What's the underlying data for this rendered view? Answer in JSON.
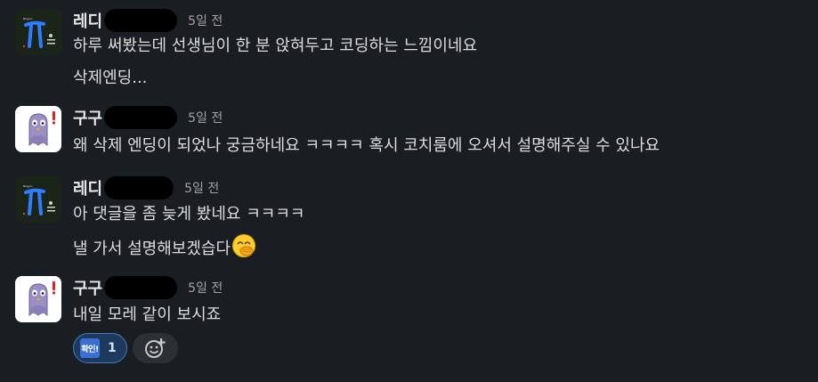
{
  "messages": [
    {
      "username": "레디",
      "timestamp": "5일 전",
      "avatar_icon": "blue-pi-character-avatar",
      "lines": [
        "하루 써봤는데 선생님이 한 분 앉혀두고 코딩하는 느낌이네요",
        "삭제엔딩..."
      ]
    },
    {
      "username": "구구",
      "timestamp": "5일 전",
      "avatar_icon": "purple-pigeon-avatar",
      "lines": [
        "왜 삭제 엔딩이 되었나 궁금하네요 ㅋㅋㅋㅋ 혹시 코치룸에 오셔서 설명해주실 수 있나요"
      ]
    },
    {
      "username": "레디",
      "timestamp": "5일 전",
      "avatar_icon": "blue-pi-character-avatar",
      "lines": [
        "아 댓글을 좀 늦게 봤네요 ㅋㅋㅋㅋ",
        "낼 가서 설명해보겠습다"
      ],
      "trailing_emoji": "hand-over-mouth-emoji"
    },
    {
      "username": "구구",
      "timestamp": "5일 전",
      "avatar_icon": "purple-pigeon-avatar",
      "lines": [
        "내일 모레 같이 보시죠"
      ]
    }
  ],
  "reactions": [
    {
      "emoji_label": "확인!",
      "count": "1",
      "icon": "confirm-badge-emoji"
    },
    {
      "icon": "add-reaction-icon"
    }
  ],
  "colors": {
    "background": "#1a1d21",
    "text": "#dcdddd",
    "timestamp": "#a0a2a6",
    "reaction_active_bg": "#1d3a5c",
    "reaction_active_border": "#3d7ec7"
  }
}
